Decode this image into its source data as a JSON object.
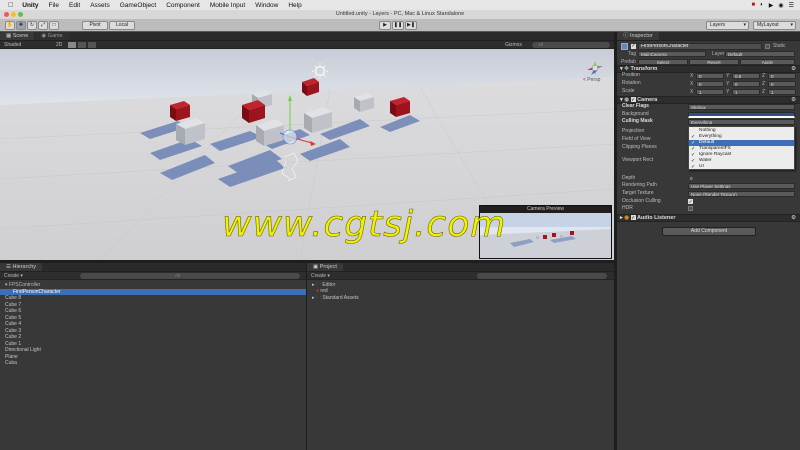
{
  "menubar": {
    "app": "Unity",
    "items": [
      "File",
      "Edit",
      "Assets",
      "GameObject",
      "Component",
      "Mobile Input",
      "Window",
      "Help"
    ],
    "status_icons": [
      "■",
      "◐",
      "▶",
      "◉",
      "☰"
    ]
  },
  "window_title": "Untitled.unity - Layers - PC, Mac & Linux Standalone",
  "toolbar": {
    "pivot": "Pivot",
    "local": "Local",
    "play": "▶",
    "pause": "❚❚",
    "step": "▶❚",
    "layers": "Layers",
    "layout": "MyLayout"
  },
  "scene": {
    "tabs": [
      "Scene",
      "Game"
    ],
    "shading": "Shaded",
    "mode_2d": "2D",
    "gizmos": "Gizmos",
    "search_placeholder": "All",
    "persp": "< Persp",
    "camera_preview_title": "Camera Preview"
  },
  "watermark": "www.cgtsj.com",
  "hierarchy": {
    "tab": "Hierarchy",
    "create": "Create ▾",
    "search_placeholder": "All",
    "items": [
      {
        "label": "▾ FPSController",
        "indent": 0,
        "selected": false,
        "color": "#b8b8b8"
      },
      {
        "label": "FirstPersonCharacter",
        "indent": 1,
        "selected": true,
        "color": "#ffffff"
      },
      {
        "label": "Cube 8",
        "indent": 0,
        "selected": false,
        "color": "#c4c4c4"
      },
      {
        "label": "Cube 7",
        "indent": 0,
        "selected": false,
        "color": "#c4c4c4"
      },
      {
        "label": "Cube 6",
        "indent": 0,
        "selected": false,
        "color": "#c4c4c4"
      },
      {
        "label": "Cube 5",
        "indent": 0,
        "selected": false,
        "color": "#c4c4c4"
      },
      {
        "label": "Cube 4",
        "indent": 0,
        "selected": false,
        "color": "#c4c4c4"
      },
      {
        "label": "Cube 3",
        "indent": 0,
        "selected": false,
        "color": "#c4c4c4"
      },
      {
        "label": "Cube 2",
        "indent": 0,
        "selected": false,
        "color": "#c4c4c4"
      },
      {
        "label": "Cube 1",
        "indent": 0,
        "selected": false,
        "color": "#c4c4c4"
      },
      {
        "label": "Directional Light",
        "indent": 0,
        "selected": false,
        "color": "#c4c4c4"
      },
      {
        "label": "Plane",
        "indent": 0,
        "selected": false,
        "color": "#c4c4c4"
      },
      {
        "label": "Cuba",
        "indent": 0,
        "selected": false,
        "color": "#c4c4c4"
      }
    ]
  },
  "project": {
    "tab": "Project",
    "create": "Create ▾",
    "items": [
      {
        "label": "Editor",
        "arrow": "▸"
      },
      {
        "label": "red",
        "arrow": ""
      },
      {
        "label": "Standard Assets",
        "arrow": "▸"
      }
    ]
  },
  "inspector": {
    "tab": "Inspector",
    "object_name": "FirstPersonCharacter",
    "static_label": "Static",
    "tag_label": "Tag",
    "tag_value": "MainCamera",
    "layer_label": "Layer",
    "layer_value": "Default",
    "prefab_label": "Prefab",
    "prefab_select": "Select",
    "prefab_revert": "Revert",
    "prefab_apply": "Apply",
    "transform": {
      "title": "Transform",
      "rows": [
        {
          "label": "Position",
          "x": "0",
          "y": "0.8",
          "z": "0"
        },
        {
          "label": "Rotation",
          "x": "0",
          "y": "0",
          "z": "0"
        },
        {
          "label": "Scale",
          "x": "1",
          "y": "1",
          "z": "1"
        }
      ]
    },
    "camera": {
      "title": "Camera",
      "clear_flags_label": "Clear Flags",
      "clear_flags_value": "Skybox",
      "background_label": "Background",
      "culling_mask_label": "Culling Mask",
      "culling_mask_value": "Everything",
      "projection_label": "Projection",
      "fov_label": "Field of View",
      "clipping_label": "Clipping Planes",
      "viewport_label": "Viewport Rect",
      "depth_label": "Depth",
      "depth_value": "0",
      "rendering_path_label": "Rendering Path",
      "rendering_path_value": "Use Player Settings",
      "target_texture_label": "Target Texture",
      "target_texture_value": "None (Render Texture)",
      "occlusion_label": "Occlusion Culling",
      "hdr_label": "HDR"
    },
    "culling_dropdown": [
      {
        "label": "Nothing",
        "checked": false,
        "selected": false
      },
      {
        "label": "Everything",
        "checked": true,
        "selected": false
      },
      {
        "label": "Default",
        "checked": true,
        "selected": true
      },
      {
        "label": "TransparentFX",
        "checked": true,
        "selected": false
      },
      {
        "label": "Ignore Raycast",
        "checked": true,
        "selected": false
      },
      {
        "label": "Water",
        "checked": true,
        "selected": false
      },
      {
        "label": "UI",
        "checked": true,
        "selected": false
      }
    ],
    "audio_listener": "Audio Listener",
    "add_component": "Add Component"
  },
  "colors": {
    "sky": "#e8ecf2",
    "ground": "#d6d6d6",
    "cube_red": "#a0141e",
    "cube_grey": "#b9bcc2",
    "shadow_blue": "#6c82b4",
    "selection": "#3d6fb8",
    "watermark": "#f5f500"
  }
}
